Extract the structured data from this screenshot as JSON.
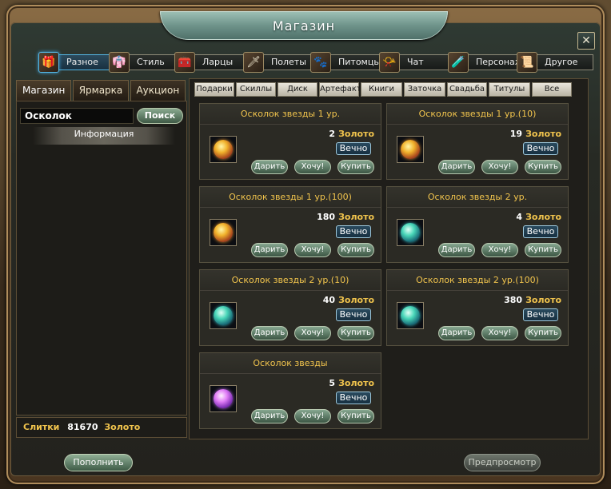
{
  "window": {
    "title": "Магазин",
    "close_label": "✕"
  },
  "categories": [
    {
      "label": "Разное",
      "icon": "gift-box-icon",
      "glyph": "🎁",
      "active": true
    },
    {
      "label": "Стиль",
      "icon": "fashion-icon",
      "glyph": "👘",
      "active": false
    },
    {
      "label": "Ларцы",
      "icon": "chest-icon",
      "glyph": "🧰",
      "active": false
    },
    {
      "label": "Полеты",
      "icon": "sword-flight-icon",
      "glyph": "🗡",
      "active": false
    },
    {
      "label": "Питомцы",
      "icon": "pet-icon",
      "glyph": "🐾",
      "active": false
    },
    {
      "label": "Чат",
      "icon": "chat-horn-icon",
      "glyph": "📯",
      "active": false
    },
    {
      "label": "Персонаж",
      "icon": "character-icon",
      "glyph": "🧪",
      "active": false
    },
    {
      "label": "Другое",
      "icon": "scroll-icon",
      "glyph": "📜",
      "active": false
    }
  ],
  "left_tabs": [
    {
      "label": "Магазин",
      "active": true
    },
    {
      "label": "Ярмарка",
      "active": false
    },
    {
      "label": "Аукцион",
      "active": false
    }
  ],
  "search": {
    "value": "Осколок",
    "button_label": "Поиск"
  },
  "info_label": "Информация",
  "balance": {
    "label": "Слитки",
    "value": "81670",
    "currency": "Золото"
  },
  "subtabs": [
    "Подарки",
    "Скиллы",
    "Диск",
    "Артефакт",
    "Книги",
    "Заточка",
    "Свадьба",
    "Титулы",
    "Все"
  ],
  "items": [
    {
      "name": "Осколок звезды 1 ур.",
      "price": "2",
      "currency": "Золото",
      "duration": "Вечно",
      "orb": "gold"
    },
    {
      "name": "Осколок звезды 1 ур.(10)",
      "price": "19",
      "currency": "Золото",
      "duration": "Вечно",
      "orb": "gold"
    },
    {
      "name": "Осколок звезды 1 ур.(100)",
      "price": "180",
      "currency": "Золото",
      "duration": "Вечно",
      "orb": "gold"
    },
    {
      "name": "Осколок звезды 2 ур.",
      "price": "4",
      "currency": "Золото",
      "duration": "Вечно",
      "orb": "teal"
    },
    {
      "name": "Осколок звезды 2 ур.(10)",
      "price": "40",
      "currency": "Золото",
      "duration": "Вечно",
      "orb": "teal"
    },
    {
      "name": "Осколок звезды 2 ур.(100)",
      "price": "380",
      "currency": "Золото",
      "duration": "Вечно",
      "orb": "teal"
    },
    {
      "name": "Осколок звезды",
      "price": "5",
      "currency": "Золото",
      "duration": "Вечно",
      "orb": "purple"
    }
  ],
  "item_buttons": {
    "gift": "Дарить",
    "want": "Хочу!",
    "buy": "Купить"
  },
  "bottom": {
    "topup_label": "Пополнить",
    "preview_label": "Предпросмотр"
  },
  "colors": {
    "gold_text": "#f1c44d",
    "active_tab": "#55b8e6",
    "button_green": "#86a790"
  }
}
